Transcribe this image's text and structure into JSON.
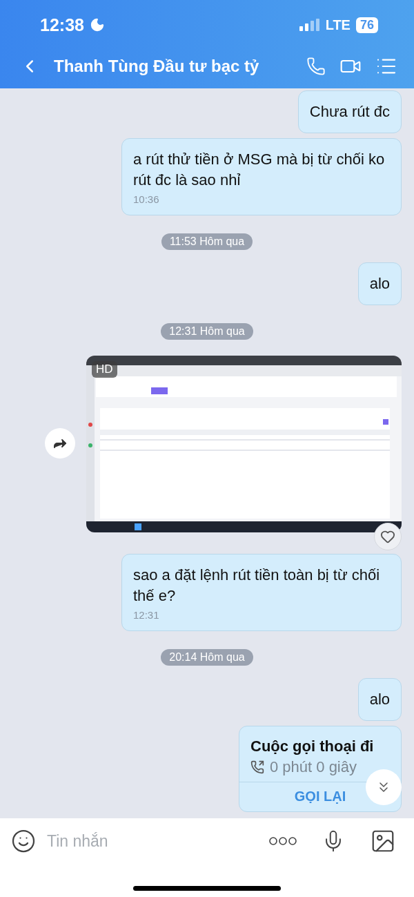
{
  "status_bar": {
    "time": "12:38",
    "network": "LTE",
    "battery": "76"
  },
  "header": {
    "title": "Thanh Tùng Đầu tư bạc tỷ"
  },
  "messages": [
    {
      "kind": "text",
      "text": "Chưa rút đc"
    },
    {
      "kind": "text",
      "text": "a rút thử tiền ở MSG mà bị từ chối ko rút đc là sao nhỉ",
      "time": "10:36"
    },
    {
      "kind": "divider",
      "text": "11:53 Hôm qua"
    },
    {
      "kind": "text",
      "text": "alo"
    },
    {
      "kind": "divider",
      "text": "12:31 Hôm qua"
    },
    {
      "badge": "HD"
    },
    {
      "kind": "text",
      "text": "sao a đặt lệnh rút tiền toàn bị từ chối thế e?",
      "time": "12:31"
    },
    {
      "kind": "divider",
      "text": "20:14 Hôm qua"
    },
    {
      "kind": "text",
      "text": "alo"
    },
    {
      "kind": "call",
      "title": "Cuộc gọi thoại đi",
      "duration": "0 phút 0 giây",
      "action": "GỌI LẠI"
    }
  ],
  "composer": {
    "placeholder": "Tin nhắn"
  }
}
